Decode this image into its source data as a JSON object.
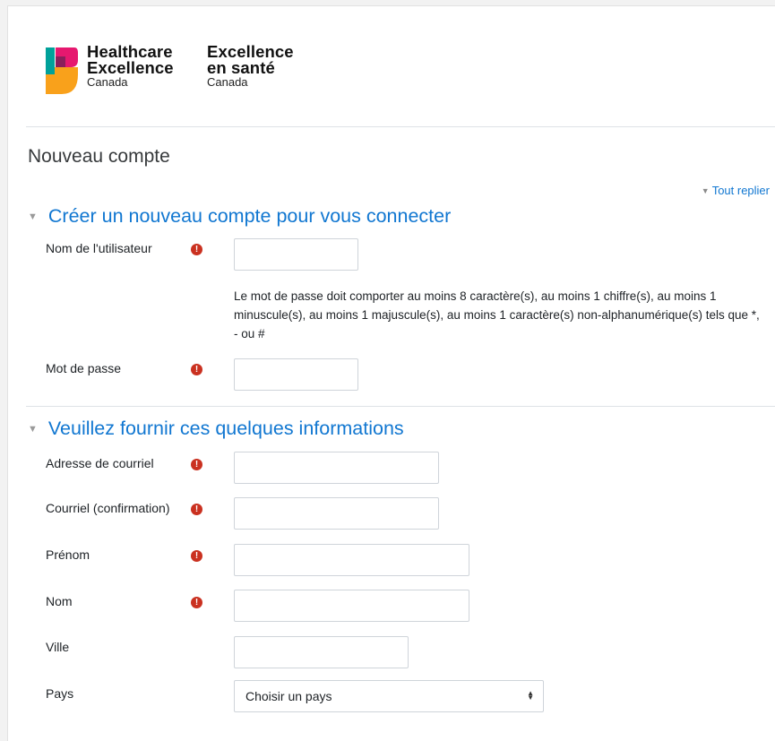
{
  "logo": {
    "en_line1": "Healthcare",
    "en_line2": "Excellence",
    "en_line3": "Canada",
    "fr_line1": "Excellence",
    "fr_line2": "en santé",
    "fr_line3": "Canada",
    "colors": [
      "#e6186f",
      "#00a19a",
      "#f9a11b",
      "#8a1f5b"
    ]
  },
  "page_title": "Nouveau compte",
  "collapse_all": "Tout replier",
  "section1": {
    "title": "Créer un nouveau compte pour vous connecter",
    "username_label": "Nom de l'utilisateur",
    "password_help": "Le mot de passe doit comporter au moins 8 caractère(s), au moins 1 chiffre(s), au moins 1 minuscule(s), au moins 1 majuscule(s), au moins 1 caractère(s) non-alphanumérique(s) tels que *, - ou #",
    "password_label": "Mot de passe"
  },
  "section2": {
    "title": "Veuillez fournir ces quelques informations",
    "email_label": "Adresse de courriel",
    "email_confirm_label": "Courriel (confirmation)",
    "firstname_label": "Prénom",
    "lastname_label": "Nom",
    "city_label": "Ville",
    "country_label": "Pays",
    "country_value": "Choisir un pays"
  },
  "required_glyph": "!",
  "colors": {
    "accent": "#1177d1",
    "required": "#ca3120"
  }
}
